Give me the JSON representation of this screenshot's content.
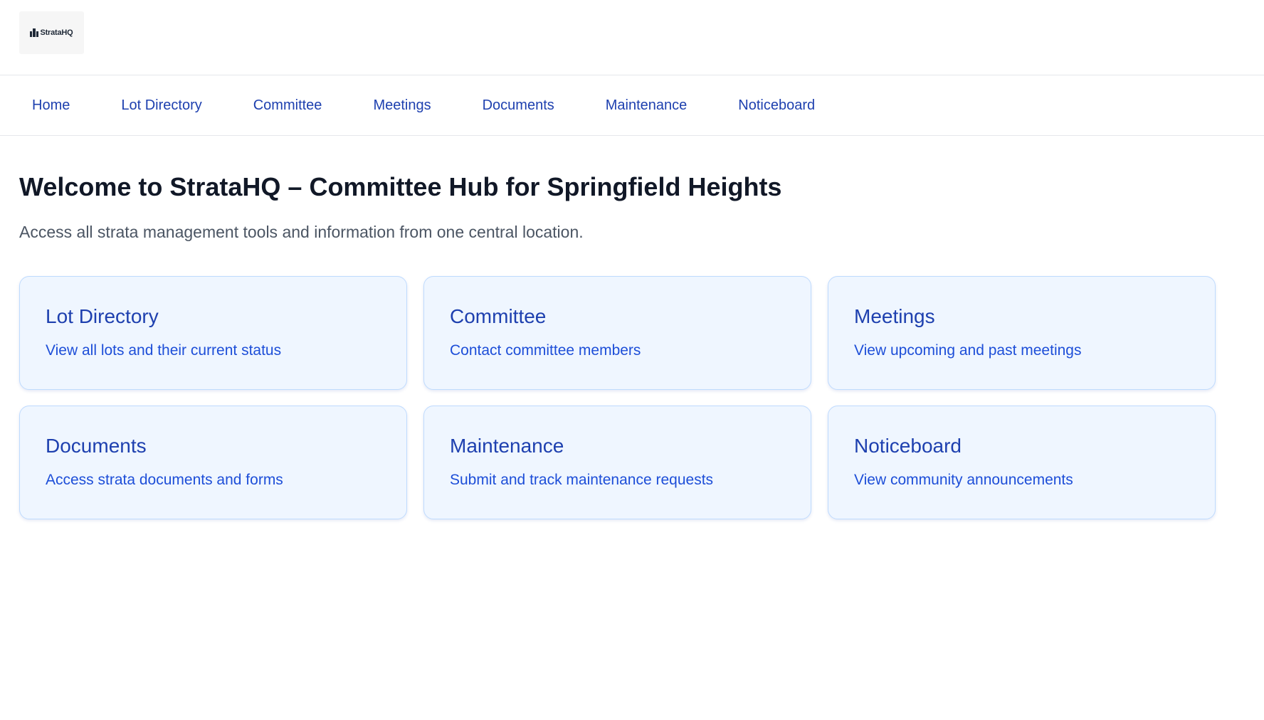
{
  "header": {
    "logo_text": "StrataHQ",
    "logo_icon": "building-icon"
  },
  "nav": {
    "items": [
      {
        "label": "Home"
      },
      {
        "label": "Lot Directory"
      },
      {
        "label": "Committee"
      },
      {
        "label": "Meetings"
      },
      {
        "label": "Documents"
      },
      {
        "label": "Maintenance"
      },
      {
        "label": "Noticeboard"
      }
    ]
  },
  "main": {
    "title": "Welcome to StrataHQ – Committee Hub for Springfield Heights",
    "subtitle": "Access all strata management tools and information from one central location.",
    "cards": [
      {
        "title": "Lot Directory",
        "description": "View all lots and their current status"
      },
      {
        "title": "Committee",
        "description": "Contact committee members"
      },
      {
        "title": "Meetings",
        "description": "View upcoming and past meetings"
      },
      {
        "title": "Documents",
        "description": "Access strata documents and forms"
      },
      {
        "title": "Maintenance",
        "description": "Submit and track maintenance requests"
      },
      {
        "title": "Noticeboard",
        "description": "View community announcements"
      }
    ]
  },
  "colors": {
    "accent": "#1e40af",
    "card_background": "#eff6ff",
    "card_border": "#bfdbfe",
    "heading": "#111827",
    "muted_text": "#4b5563"
  }
}
